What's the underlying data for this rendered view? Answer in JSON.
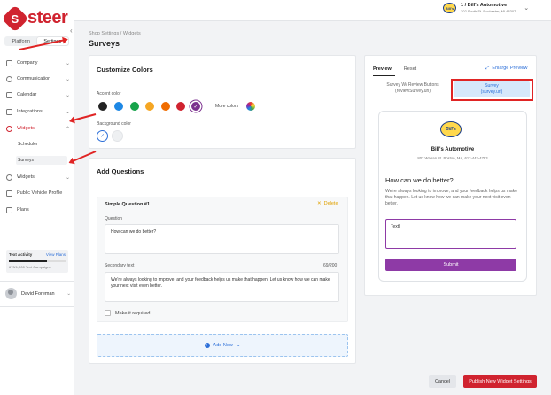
{
  "brand": {
    "name": "steer",
    "icon": "steer-logo-icon"
  },
  "sidebar": {
    "segments": [
      "Platform",
      "Settings"
    ],
    "items": [
      {
        "label": "Company",
        "icon": "building-icon"
      },
      {
        "label": "Communication",
        "icon": "chat-icon"
      },
      {
        "label": "Calendar",
        "icon": "calendar-icon"
      },
      {
        "label": "Integrations",
        "icon": "integrations-icon"
      },
      {
        "label": "Widgets",
        "icon": "widget-icon"
      },
      {
        "label": "Widgets",
        "icon": "widget-icon"
      },
      {
        "label": "Public Vehicle Profile",
        "icon": "car-icon"
      },
      {
        "label": "Plans",
        "icon": "plans-icon"
      }
    ],
    "subitems": [
      "Scheduler",
      "Surveys"
    ],
    "text_activity": {
      "label": "Text Activity",
      "link": "View Plans",
      "usage": "670/1,000 Text Campaigns",
      "fraction": 0.67
    },
    "user": {
      "name": "David Foreman"
    }
  },
  "account": {
    "name": "1 / Bill's Automotive",
    "address": "202 South St. Rochester, MI 48307",
    "logo_text": "Bill's"
  },
  "breadcrumb": "Shop Settings / Widgets",
  "page_title": "Surveys",
  "colors": {
    "title": "Customize Colors",
    "accent_label": "Accent color",
    "accent_swatches": [
      "#222222",
      "#1e88e5",
      "#16a34a",
      "#f5a623",
      "#f06c00",
      "#d0232f",
      "#7b2f8e"
    ],
    "more_colors": "More colors",
    "background_label": "Background color"
  },
  "questions": {
    "title": "Add Questions",
    "q_title": "Simple Question #1",
    "delete": "Delete",
    "question_label": "Question",
    "question_value": "How can we do better?",
    "secondary_label": "Secondary text",
    "secondary_count": "69/200",
    "secondary_value": "We're always looking to improve, and your feedback helps us make that happen. Let us know how we can make your next visit even better.",
    "required_label": "Make it required",
    "add_new": "Add New"
  },
  "preview": {
    "tabs": [
      "Preview",
      "Reset"
    ],
    "enlarge": "Enlarge Preview",
    "option1": "Survey W/ Review Buttons (reviewSurvey.url)",
    "option2_line1": "Survey",
    "option2_line2": "(survey.url)",
    "shop_name": "Bill's Automotive",
    "shop_address": "807 Warren St. Boston, MA, 617-442-4793",
    "heading": "How can we do better?",
    "body": "We're always looking to improve, and your feedback helps us make that happen. Let us know how we can make your next visit even better.",
    "input_value": "Text|",
    "submit": "Submit"
  },
  "footer": {
    "cancel": "Cancel",
    "publish": "Publish New Widget Settings"
  }
}
